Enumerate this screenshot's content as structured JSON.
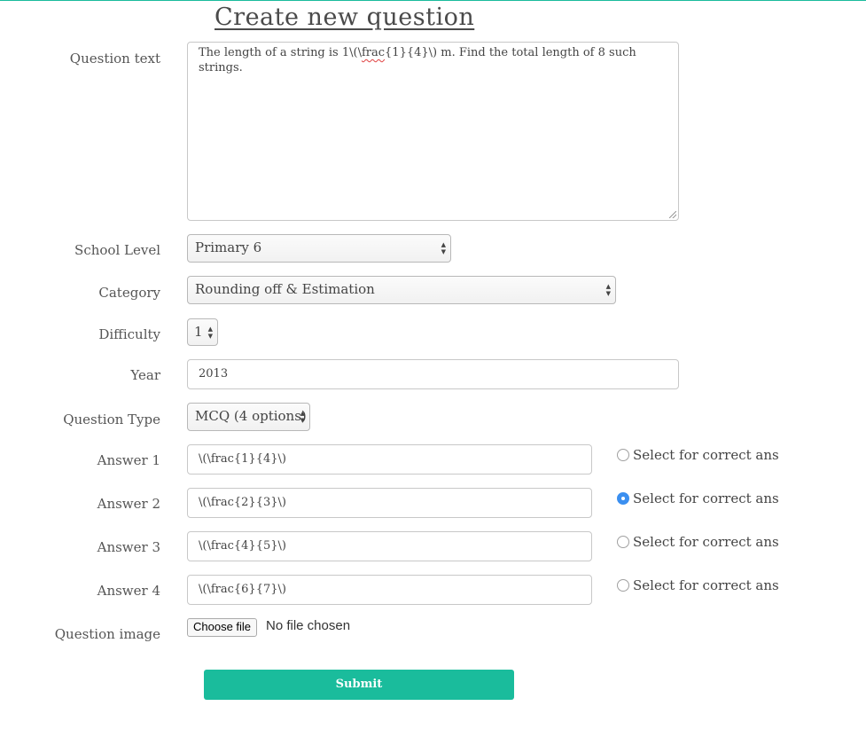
{
  "page": {
    "title": "Create new question",
    "accent_color": "#1abc9c",
    "radio_checked_color": "#3b8ff0"
  },
  "form": {
    "question_text": {
      "label": "Question text",
      "value_before": "The length of a string is 1\\(\\",
      "value_misspelled": "frac",
      "value_after": "{1}{4}\\) m. Find the total length of 8 such strings."
    },
    "school_level": {
      "label": "School Level",
      "value": "Primary 6"
    },
    "category": {
      "label": "Category",
      "value": "Rounding off & Estimation"
    },
    "difficulty": {
      "label": "Difficulty",
      "value": "1"
    },
    "year": {
      "label": "Year",
      "value": "2013"
    },
    "question_type": {
      "label": "Question Type",
      "value": "MCQ (4 options)"
    },
    "answers": [
      {
        "label": "Answer 1",
        "value": "\\(\\frac{1}{4}\\)",
        "radio_label": "Select for correct ans",
        "selected": false
      },
      {
        "label": "Answer 2",
        "value": "\\(\\frac{2}{3}\\)",
        "radio_label": "Select for correct ans",
        "selected": true
      },
      {
        "label": "Answer 3",
        "value": "\\(\\frac{4}{5}\\)",
        "radio_label": "Select for correct ans",
        "selected": false
      },
      {
        "label": "Answer 4",
        "value": "\\(\\frac{6}{7}\\)",
        "radio_label": "Select for correct ans",
        "selected": false
      }
    ],
    "question_image": {
      "label": "Question image",
      "button_label": "Choose file",
      "status_text": "No file chosen"
    },
    "submit_label": "Submit"
  }
}
